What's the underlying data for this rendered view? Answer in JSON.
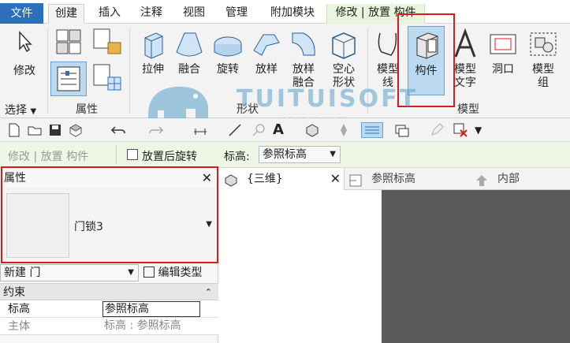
{
  "menu_tabs": [
    {
      "label": "文件"
    },
    {
      "label": "创建"
    },
    {
      "label": "插入"
    },
    {
      "label": "注释"
    },
    {
      "label": "视图"
    },
    {
      "label": "管理"
    },
    {
      "label": "附加模块"
    },
    {
      "label": "修改 | 放置 构件"
    }
  ],
  "ribbon": {
    "modify_label": "修改",
    "select_label": "选择",
    "properties_panel_label": "属性",
    "buttons": {
      "extrude": "拉伸",
      "blend": "融合",
      "revolve": "旋转",
      "sweep": "放样",
      "swept_blend_l1": "放样",
      "swept_blend_l2": "融合",
      "void_l1": "空心",
      "void_l2": "形状",
      "model_line_l1": "模型",
      "model_line_l2": "线",
      "component": "构件",
      "model_text_l1": "模型",
      "model_text_l2": "文字",
      "opening": "洞口",
      "model_group_l1": "模型",
      "model_group_l2": "组"
    },
    "form_panel_label": "形状",
    "model_panel_label": "模型"
  },
  "watermark": {
    "brand": "TUITUISOFT",
    "sub": "腿腿教学网"
  },
  "options_bar": {
    "context_label": "修改 | 放置 构件",
    "rotate_after_place": "放置后旋转",
    "level_label": "标高:",
    "level_value": "参照标高"
  },
  "properties": {
    "title": "属性",
    "close_glyph": "✕",
    "family_type": "门锁3",
    "new_label": "新建 门",
    "edit_type": "编辑类型",
    "section": "约束",
    "rows": [
      {
        "key": "标高",
        "value": "参照标高"
      },
      {
        "key": "主体",
        "value": "标高 : 参照标高"
      }
    ]
  },
  "view_tabs": [
    {
      "label": "{三维}"
    },
    {
      "label": "参照标高"
    },
    {
      "label": "内部"
    }
  ],
  "colors": {
    "file_tab": "#2b6fbd",
    "highlight": "#e01818",
    "context_tab": "#e9f5dc",
    "viewport_bg": "#5b5b5b",
    "component_selected": "#bcd9f2"
  }
}
